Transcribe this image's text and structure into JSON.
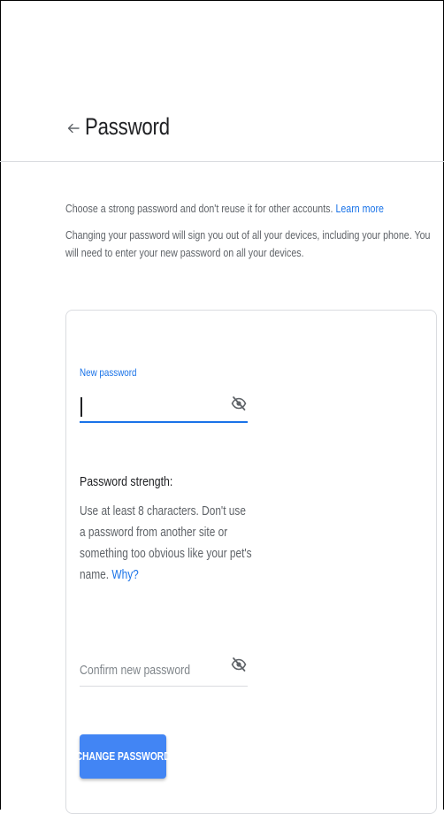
{
  "header": {
    "back_icon": "arrow-back-icon",
    "title": "Password"
  },
  "intro": {
    "line1_text": "Choose a strong password and don't reuse it for other accounts.",
    "learn_more": "Learn more",
    "line2_text": "Changing your password will sign you out of all your devices, including your phone. You will need to enter your new password on all your devices."
  },
  "form": {
    "new_password": {
      "label": "New password",
      "value": "",
      "visibility_icon": "eye-off-icon"
    },
    "strength": {
      "title": "Password strength:",
      "description": "Use at least 8 characters. Don't use a password from another site or something too obvious like your pet's name.",
      "why_link": "Why?"
    },
    "confirm_password": {
      "placeholder": "Confirm new password",
      "value": "",
      "visibility_icon": "eye-off-icon"
    },
    "submit_label": "CHANGE PASSWORD"
  },
  "colors": {
    "accent": "#1a73e8",
    "button": "#4285f4",
    "text_secondary": "#5f6368",
    "divider": "#dadce0"
  }
}
